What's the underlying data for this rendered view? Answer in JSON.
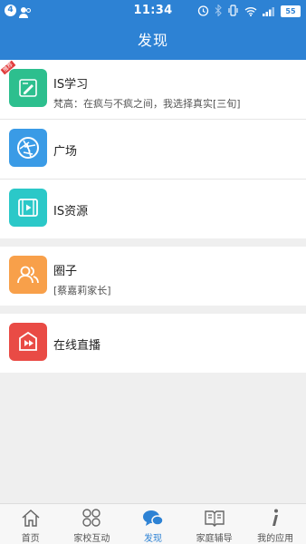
{
  "status_bar": {
    "notification_count": "4",
    "time": "11:34",
    "battery": "55"
  },
  "nav": {
    "title": "发现"
  },
  "sections": [
    [
      {
        "id": "is-study",
        "title": "IS学习",
        "subtitle": "梵高：在疯与不疯之间，我选择真实[三旬]",
        "ribbon": "推荐",
        "color": "#2dbf8e",
        "icon": "pencil-ruler-icon"
      },
      {
        "id": "plaza",
        "title": "广场",
        "color": "#3a9be6",
        "icon": "aperture-icon"
      },
      {
        "id": "is-resources",
        "title": "IS资源",
        "color": "#2bc8c8",
        "icon": "film-icon"
      }
    ],
    [
      {
        "id": "circle",
        "title": "圈子",
        "subtitle": "[蔡嘉莉家长]",
        "color": "#f8a04a",
        "icon": "people-icon"
      }
    ],
    [
      {
        "id": "live",
        "title": "在线直播",
        "color": "#e94b45",
        "icon": "play-box-icon"
      }
    ]
  ],
  "tabs": [
    {
      "label": "首页",
      "icon": "home-icon"
    },
    {
      "label": "家校互动",
      "icon": "grid-circles-icon"
    },
    {
      "label": "发现",
      "icon": "chat-bubbles-icon",
      "active": true
    },
    {
      "label": "家庭辅导",
      "icon": "book-icon"
    },
    {
      "label": "我的应用",
      "icon": "info-icon"
    }
  ]
}
